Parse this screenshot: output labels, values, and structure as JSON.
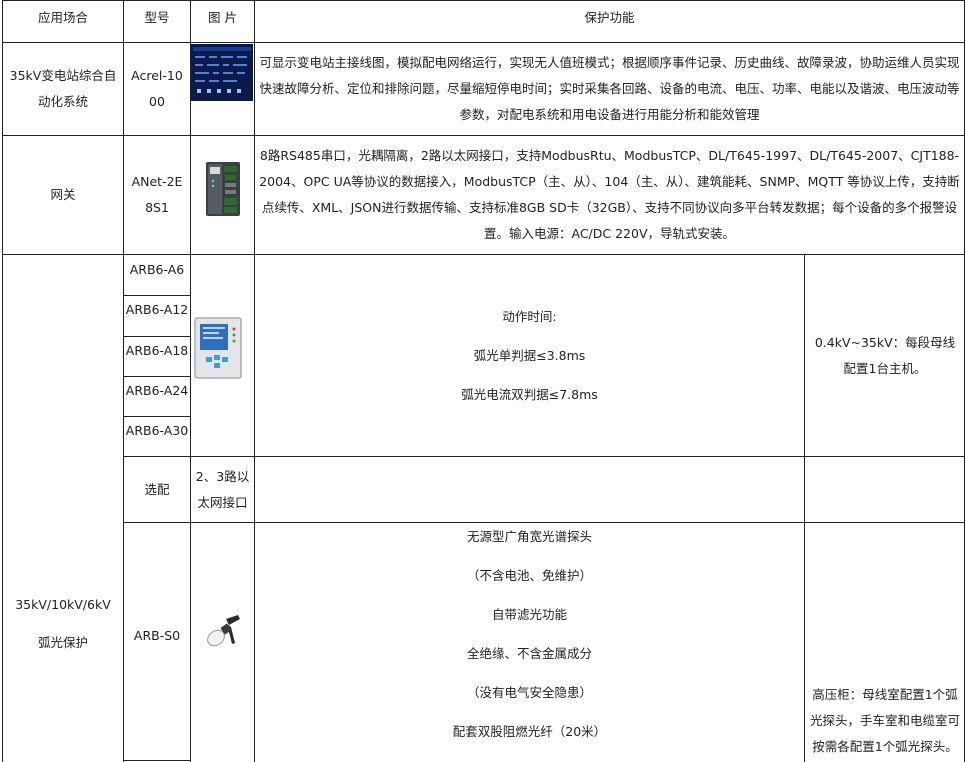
{
  "headers": [
    "应用场合",
    "型号",
    "图 片",
    "保护功能"
  ],
  "rows": {
    "scada": {
      "scene": "35kV变电站综合自动化系统",
      "model": "Acrel-1000",
      "image_icon": "scada-screen-icon",
      "function": "可显示变电站主接线图，模拟配电网络运行，实现无人值班模式；根据顺序事件记录、历史曲线、故障录波，协助运维人员实现快速故障分析、定位和排除问题，尽量缩短停电时间；实时采集各回路、设备的电流、电压、功率、电能以及谐波、电压波动等参数，对配电系统和用电设备进行用能分析和能效管理"
    },
    "gateway": {
      "scene": "网关",
      "model": "ANet-2E8S1",
      "image_icon": "gateway-device-icon",
      "function": "8路RS485串口，光耦隔离，2路以太网接口，支持ModbusRtu、ModbusTCP、DL/T645-1997、DL/T645-2007、CJT188-2004、OPC UA等协议的数据接入，ModbusTCP（主、从）、104（主、从）、建筑能耗、SNMP、MQTT 等协议上传，支持断点续传、XML、JSON进行数据传输、支持标准8GB SD卡（32GB）、支持不同协议向多平台转发数据；每个设备的多个报警设置。输入电源：AC/DC 220V，导轨式安装。"
    },
    "arc": {
      "scene_lines": [
        "35kV/10kV/6kV",
        "弧光保护"
      ],
      "models": [
        "ARB6-A6",
        "ARB6-A12",
        "ARB6-A18",
        "ARB6-A24",
        "ARB6-A30"
      ],
      "host_image_icon": "arc-protection-host-icon",
      "host_function": [
        "动作时间:",
        "弧光单判据≤3.8ms",
        "弧光电流双判据≤7.8ms"
      ],
      "host_note": "0.4kV~35kV：每段母线配置1台主机。",
      "option_label": "选配",
      "option_text": "2、3路以太网接口",
      "probe_model": "ARB-S0",
      "probe_image_icon": "arc-probe-icon",
      "probe_function": [
        "无源型广角宽光谱探头",
        "（不含电池、免维护）",
        "自带滤光功能",
        "全绝缘、不含金属成分",
        "（没有电气安全隐患）",
        "配套双股阻燃光纤（20米）"
      ],
      "probe_note": "高压柜：母线室配置1个弧光探头，手车室和电缆室可按需各配置1个弧光探头。"
    }
  }
}
